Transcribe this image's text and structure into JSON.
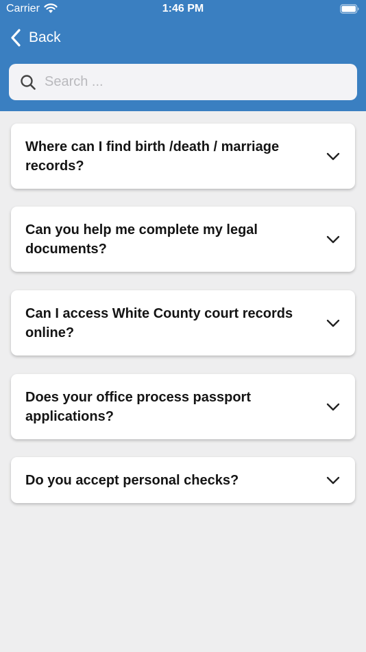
{
  "status_bar": {
    "carrier": "Carrier",
    "time": "1:46 PM"
  },
  "nav": {
    "back_label": "Back"
  },
  "search": {
    "placeholder": "Search ..."
  },
  "faq": {
    "items": [
      {
        "question": "Where can I find birth /death / marriage records?"
      },
      {
        "question": "Can you help me complete my legal documents?"
      },
      {
        "question": "Can I access White County court records online?"
      },
      {
        "question": "Does your office process passport applications?"
      },
      {
        "question": "Do you accept personal checks?"
      }
    ]
  },
  "colors": {
    "header_background": "#3a7fc1",
    "page_background": "#eeeeef",
    "card_background": "#ffffff"
  },
  "icons": {
    "wifi": "wifi-icon",
    "battery": "battery-icon",
    "back": "chevron-left-icon",
    "search": "search-icon",
    "expand": "chevron-down-icon"
  }
}
